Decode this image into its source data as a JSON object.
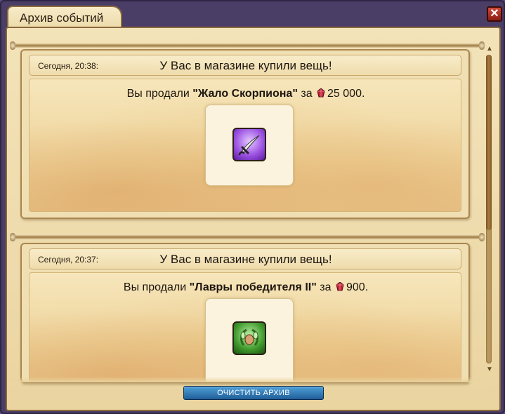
{
  "window": {
    "title": "Архив событий",
    "close_label": "✕"
  },
  "events": [
    {
      "time": "Сегодня, 20:38:",
      "title": "У Вас в магазине купили вещь!",
      "prefix": "Вы продали ",
      "item_name": "\"Жало Скорпиона\"",
      "middle": " за ",
      "amount": "25 000.",
      "item_icon": "dagger-icon"
    },
    {
      "time": "Сегодня, 20:37:",
      "title": "У Вас в магазине купили вещь!",
      "prefix": "Вы продали ",
      "item_name": "\"Лавры победителя II\"",
      "middle": " за ",
      "amount": "900.",
      "item_icon": "laurel-wreath-icon"
    }
  ],
  "footer": {
    "clear_button": "ОЧИСТИТЬ АРХИВ"
  },
  "colors": {
    "window_frame": "#4a3d66",
    "parchment": "#f0dfb2",
    "button_blue": "#1f5d98",
    "gem_red": "#c0243a"
  }
}
